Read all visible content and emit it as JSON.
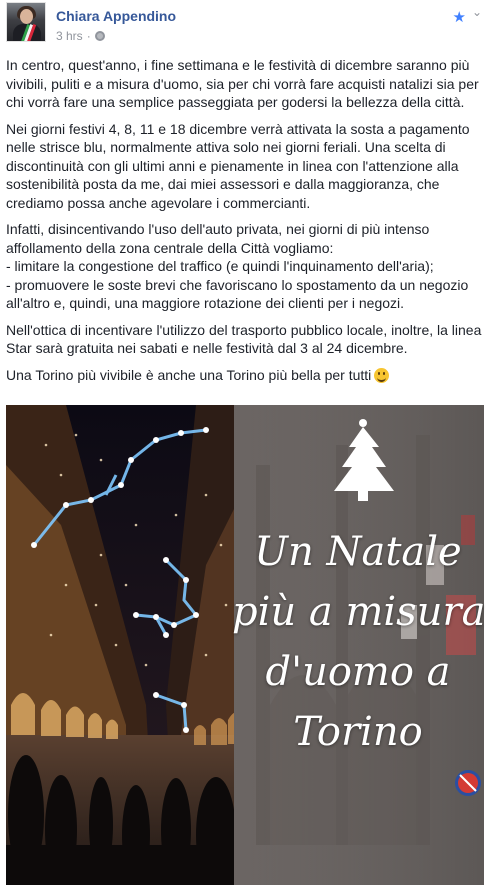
{
  "post": {
    "author": "Chiara Appendino",
    "time": "3 hrs",
    "paragraphs": [
      "In centro, quest'anno, i fine settimana e le festività di dicembre saranno più vivibili, puliti e a misura d'uomo, sia per chi vorrà fare acquisti natalizi sia per chi vorrà fare una semplice passeggiata per godersi la bellezza della città.",
      "Nei giorni festivi 4, 8, 11 e 18 dicembre verrà attivata la sosta a pagamento nelle strisce blu, normalmente attiva solo nei giorni feriali. Una scelta di discontinuità con gli ultimi anni e pienamente in linea con l'attenzione alla sostenibilità posta da me, dai miei assessori e dalla maggioranza, che crediamo possa anche agevolare i commercianti.",
      "Infatti, disincentivando l'uso dell'auto privata, nei giorni di più intenso affollamento della zona centrale della Città vogliamo:\n- limitare la congestione del traffico (e quindi l'inquinamento dell'aria);\n- promuovere le soste brevi che favoriscano lo spostamento da un negozio all'altro e, quindi, una maggiore rotazione dei clienti per i negozi.",
      "Nell'ottica di incentivare l'utilizzo del trasporto pubblico locale, inoltre, la linea Star sarà gratuita nei sabati e nelle festività dal 3 al 24 dicembre.",
      "Una Torino più vivibile è anche una Torino più bella per tutti"
    ],
    "image_text": [
      "Un Natale",
      "più a misura",
      "d'uomo a",
      "Torino"
    ],
    "icons": {
      "star": "star-icon",
      "chevron": "chevron-down-icon",
      "globe": "globe-icon",
      "emoji": "smile-emoji-icon",
      "tree": "christmas-tree-icon"
    },
    "colors": {
      "author": "#365899",
      "meta": "#90949c",
      "text": "#1d2129",
      "star": "#4080ff"
    }
  }
}
